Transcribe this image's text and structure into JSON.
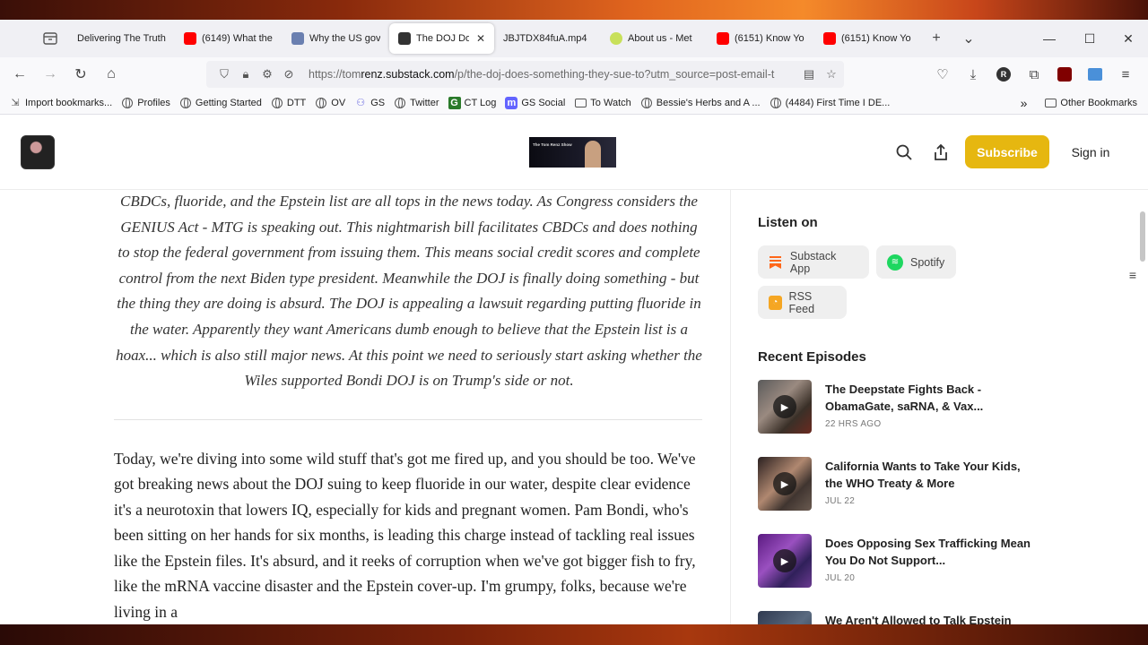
{
  "tabs": [
    {
      "title": "Delivering The Truth",
      "favicon_color": "#e9e9ee",
      "active": false
    },
    {
      "title": "(6149) What the",
      "favicon_color": "#ff0000",
      "active": false
    },
    {
      "title": "Why the US gov",
      "favicon_color": "#6a7fb0",
      "active": false
    },
    {
      "title": "The DOJ Does",
      "favicon_color": "#333333",
      "active": true
    },
    {
      "title": "JBJTDX84fuA.mp4",
      "favicon_color": "#e9e9ee",
      "active": false
    },
    {
      "title": "About us - Met",
      "favicon_color": "#c8e05a",
      "active": false
    },
    {
      "title": "(6151) Know Yo",
      "favicon_color": "#ff0000",
      "active": false
    },
    {
      "title": "(6151) Know Yo",
      "favicon_color": "#ff0000",
      "active": false
    }
  ],
  "url": {
    "prefix": "https://tom",
    "domain": "renz.substack.com",
    "rest": "/p/the-doj-does-something-they-sue-to?utm_source=post-email-t"
  },
  "bookmarks": [
    {
      "label": "Import bookmarks...",
      "icon": "import-icon"
    },
    {
      "label": "Profiles",
      "icon": "globe-icon"
    },
    {
      "label": "Getting Started",
      "icon": "globe-icon"
    },
    {
      "label": "DTT",
      "icon": "globe-icon"
    },
    {
      "label": "OV",
      "icon": "globe-icon"
    },
    {
      "label": "GS",
      "icon": "gs-icon"
    },
    {
      "label": "Twitter",
      "icon": "globe-icon"
    },
    {
      "label": "CT Log",
      "icon": "ctlog-icon"
    },
    {
      "label": "GS Social",
      "icon": "mastodon-icon"
    },
    {
      "label": "To Watch",
      "icon": "folder-icon"
    },
    {
      "label": "Bessie's Herbs and A ...",
      "icon": "globe-icon"
    },
    {
      "label": "(4484) First Time I DE...",
      "icon": "globe-icon"
    }
  ],
  "bookmarks_other": "Other Bookmarks",
  "header": {
    "banner_text": "The Tom Renz Show",
    "subscribe": "Subscribe",
    "signin": "Sign in"
  },
  "article": {
    "summary": "CBDCs, fluoride, and the Epstein list are all tops in the news today. As Congress considers the GENIUS Act - MTG is speaking out. This nightmarish bill facilitates CBDCs and does nothing to stop the federal government from issuing them. This means social credit scores and complete control from the next Biden type president. Meanwhile the DOJ is finally doing something - but the thing they are doing is absurd. The DOJ is appealing a lawsuit regarding putting fluoride in the water. Apparently they want Americans dumb enough to believe that the Epstein list is a hoax... which is also still major news. At this point we need to seriously start asking whether the Wiles supported Bondi DOJ is on Trump's side or not.",
    "body": "Today, we're diving into some wild stuff that's got me fired up, and you should be too. We've got breaking news about the DOJ suing to keep fluoride in our water, despite clear evidence it's a neurotoxin that lowers IQ, especially for kids and pregnant women. Pam Bondi, who's been sitting on her hands for six months, is leading this charge instead of tackling real issues like the Epstein files. It's absurd, and it reeks of corruption when we've got bigger fish to fry, like the mRNA vaccine disaster and the Epstein cover-up. I'm grumpy, folks, because we're living in a"
  },
  "sidebar": {
    "listen_on": "Listen on",
    "chips": [
      {
        "label": "Substack App",
        "icon": "substack-icon",
        "color": "#ff6719"
      },
      {
        "label": "Spotify",
        "icon": "spotify-icon",
        "color": "#1ed760"
      },
      {
        "label": "RSS Feed",
        "icon": "rss-icon",
        "color": "#f5a623"
      }
    ],
    "recent_episodes": "Recent Episodes",
    "episodes": [
      {
        "title": "The Deepstate Fights Back - ObamaGate, saRNA, & Vax...",
        "date": "22 HRS AGO"
      },
      {
        "title": "California Wants to Take Your Kids, the WHO Treaty & More",
        "date": "JUL 22"
      },
      {
        "title": "Does Opposing Sex Trafficking Mean You Do Not Support...",
        "date": "JUL 20"
      },
      {
        "title": "We Aren't Allowed to Talk Epstein",
        "date": ""
      }
    ]
  }
}
